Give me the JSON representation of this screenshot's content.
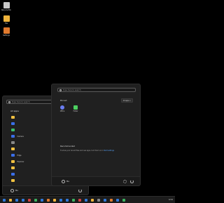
{
  "desktop": {
    "icons": [
      {
        "name": "recycle-bin-icon",
        "label": "Recycle Bin",
        "color": "#c8c8c8"
      },
      {
        "name": "app-icon",
        "label": "File",
        "color": "#f0b43c"
      },
      {
        "name": "app-icon",
        "label": "Settings",
        "color": "#e07a2e"
      }
    ]
  },
  "back_panel": {
    "search_placeholder": "Type here to search",
    "header": "All apps",
    "items": [
      {
        "letter": "",
        "label": "",
        "color": "#f0c040"
      },
      {
        "letter": "",
        "label": "",
        "color": "#3a6ee8"
      },
      {
        "letter": "",
        "label": "",
        "color": "#3dbb6a"
      },
      {
        "letter": "",
        "label": "Camera",
        "color": "#3a6ee8"
      },
      {
        "letter": "",
        "label": "",
        "color": "#888"
      },
      {
        "letter": "",
        "label": "",
        "color": "#f0c040"
      },
      {
        "letter": "",
        "label": "Edge",
        "color": "#3a6ee8"
      },
      {
        "letter": "",
        "label": "Explorer",
        "color": "#f0c040"
      },
      {
        "letter": "",
        "label": "",
        "color": "#f0c040"
      },
      {
        "letter": "",
        "label": "",
        "color": "#3a6ee8"
      },
      {
        "letter": "",
        "label": "",
        "color": "#f0c040"
      },
      {
        "letter": "",
        "label": "",
        "color": "#3a6ee8"
      }
    ],
    "user": "Me"
  },
  "front_panel": {
    "search_placeholder": "Type here to search",
    "pinned_title": "Pinned",
    "all_apps_label": "All apps >",
    "pinned": [
      {
        "label": "Office",
        "color": "#6a7cf0"
      },
      {
        "label": "Folder",
        "color": "#4cd060"
      }
    ],
    "recommended_title": "Recommended",
    "recommended_text": "To show your recent files and new apps, turn them on in",
    "recommended_link": "Start settings",
    "user": "Me"
  },
  "taskbar": {
    "icons": [
      "#2f78d8",
      "#f0b43c",
      "#2f78d8",
      "#2f78d8",
      "#d04040",
      "#3cb060",
      "#2f78d8",
      "#e07a2e",
      "#f0b43c",
      "#2f78d8",
      "#2f78d8",
      "#3cb060",
      "#d04040",
      "#2f78d8",
      "#f0b43c",
      "#888",
      "#2f78d8",
      "#e07a2e",
      "#2f78d8",
      "#3cb060"
    ],
    "time": "12:00"
  }
}
